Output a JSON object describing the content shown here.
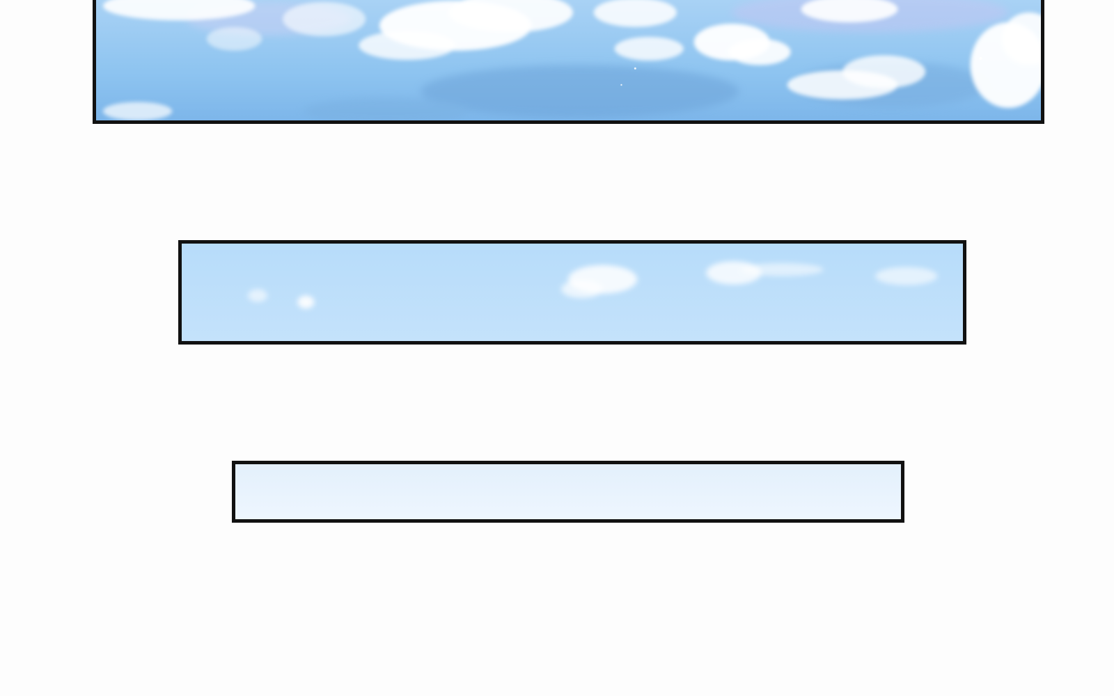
{
  "colors": {
    "page_background": "#fdfdfd",
    "panel_border": "#111111",
    "sky_top_panel": "#8ec4f0",
    "sky_middle_panel": "#bfe1fb",
    "sky_bottom_panel": "#e8f3fd",
    "cloud": "#ffffff"
  },
  "panels": [
    {
      "label": "sky-with-clouds"
    },
    {
      "label": "pale-sky-with-wisps"
    },
    {
      "label": "faint-sky"
    }
  ]
}
